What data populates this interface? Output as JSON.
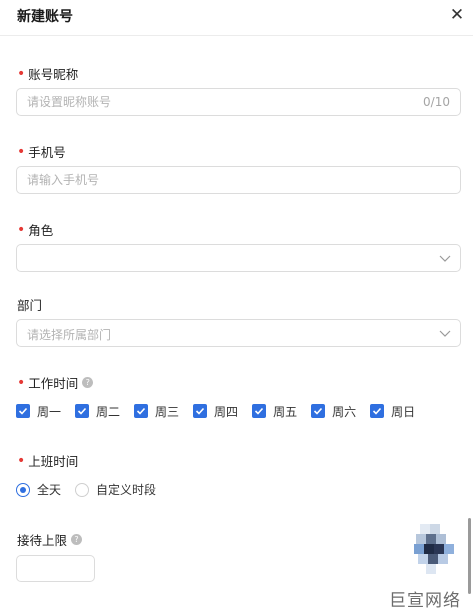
{
  "dialog": {
    "title": "新建账号",
    "close_icon": "close-icon"
  },
  "colors": {
    "primary": "#2f6fe0",
    "required": "#e53935"
  },
  "fields": {
    "nickname": {
      "label": "账号昵称",
      "placeholder": "请设置昵称账号",
      "counter": "0/10",
      "required": true
    },
    "phone": {
      "label": "手机号",
      "placeholder": "请输入手机号",
      "required": true
    },
    "role": {
      "label": "角色",
      "required": true,
      "value": ""
    },
    "department": {
      "label": "部门",
      "placeholder": "请选择所属部门",
      "required": false
    },
    "work_time": {
      "label": "工作时间",
      "required": true,
      "days": [
        {
          "label": "周一",
          "checked": true
        },
        {
          "label": "周二",
          "checked": true
        },
        {
          "label": "周三",
          "checked": true
        },
        {
          "label": "周四",
          "checked": true
        },
        {
          "label": "周五",
          "checked": true
        },
        {
          "label": "周六",
          "checked": true
        },
        {
          "label": "周日",
          "checked": true
        }
      ]
    },
    "shift_time": {
      "label": "上班时间",
      "required": true,
      "options": [
        {
          "label": "全天",
          "selected": true
        },
        {
          "label": "自定义时段",
          "selected": false
        }
      ]
    },
    "reception_limit": {
      "label": "接待上限",
      "value": ""
    }
  },
  "watermark": "巨宣网络"
}
